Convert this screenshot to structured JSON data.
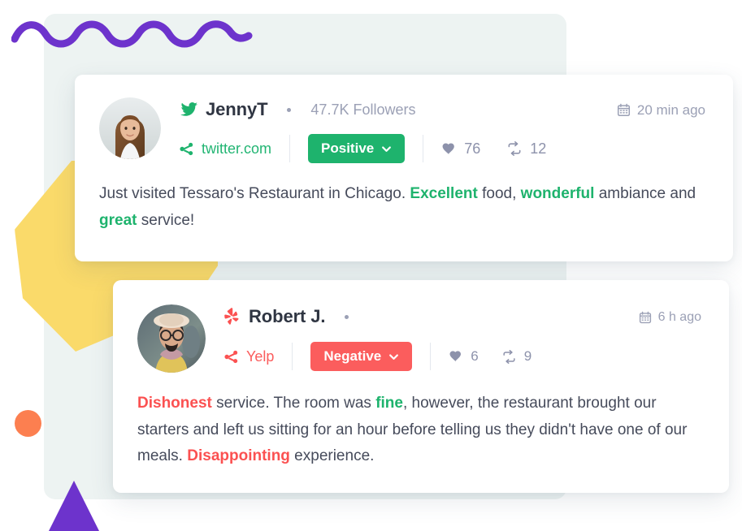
{
  "decor": {
    "panel_color": "#edf3f2",
    "wave_color": "#6d33cc",
    "blob_color": "#fada6a",
    "circle_color": "#fc7f50",
    "triangle_color": "#6d33cc"
  },
  "colors": {
    "positive": "#1eb36d",
    "negative": "#fb5d5d",
    "muted": "#9ba0b5",
    "text": "#464b5b"
  },
  "cards": [
    {
      "id": "positive",
      "avatar_name": "avatar-jennyt",
      "brand_icon": "twitter-bird-icon",
      "name": "JennyT",
      "followers": "47.7K Followers",
      "timestamp": "20 min ago",
      "timestamp_icon": "calendar-icon",
      "source_icon": "share-icon",
      "source": "twitter.com",
      "sentiment": "Positive",
      "sentiment_chevron": "chevron-down-icon",
      "likes_icon": "heart-icon",
      "likes": "76",
      "shares_icon": "retweet-icon",
      "shares": "12",
      "text_parts": [
        {
          "t": "Just visited Tessaro's Restaurant in Chicago. ",
          "hl": "none"
        },
        {
          "t": "Excellent",
          "hl": "pos"
        },
        {
          "t": " food, ",
          "hl": "none"
        },
        {
          "t": "wonderful",
          "hl": "pos"
        },
        {
          "t": " ambiance and ",
          "hl": "none"
        },
        {
          "t": "great",
          "hl": "pos"
        },
        {
          "t": " service!",
          "hl": "none"
        }
      ]
    },
    {
      "id": "negative",
      "avatar_name": "avatar-robertj",
      "brand_icon": "yelp-burst-icon",
      "name": "Robert J.",
      "followers": "",
      "timestamp": "6 h ago",
      "timestamp_icon": "calendar-icon",
      "source_icon": "share-icon",
      "source": "Yelp",
      "sentiment": "Negative",
      "sentiment_chevron": "chevron-down-icon",
      "likes_icon": "heart-icon",
      "likes": "6",
      "shares_icon": "retweet-icon",
      "shares": "9",
      "text_parts": [
        {
          "t": "Dishonest",
          "hl": "neg"
        },
        {
          "t": " service. The room was ",
          "hl": "none"
        },
        {
          "t": "fine",
          "hl": "pos"
        },
        {
          "t": ", however, the restaurant brought our starters and left us sitting for an hour before telling us they didn't have one of our meals. ",
          "hl": "none"
        },
        {
          "t": "Disappointing",
          "hl": "neg"
        },
        {
          "t": " experience.",
          "hl": "none"
        }
      ]
    }
  ]
}
